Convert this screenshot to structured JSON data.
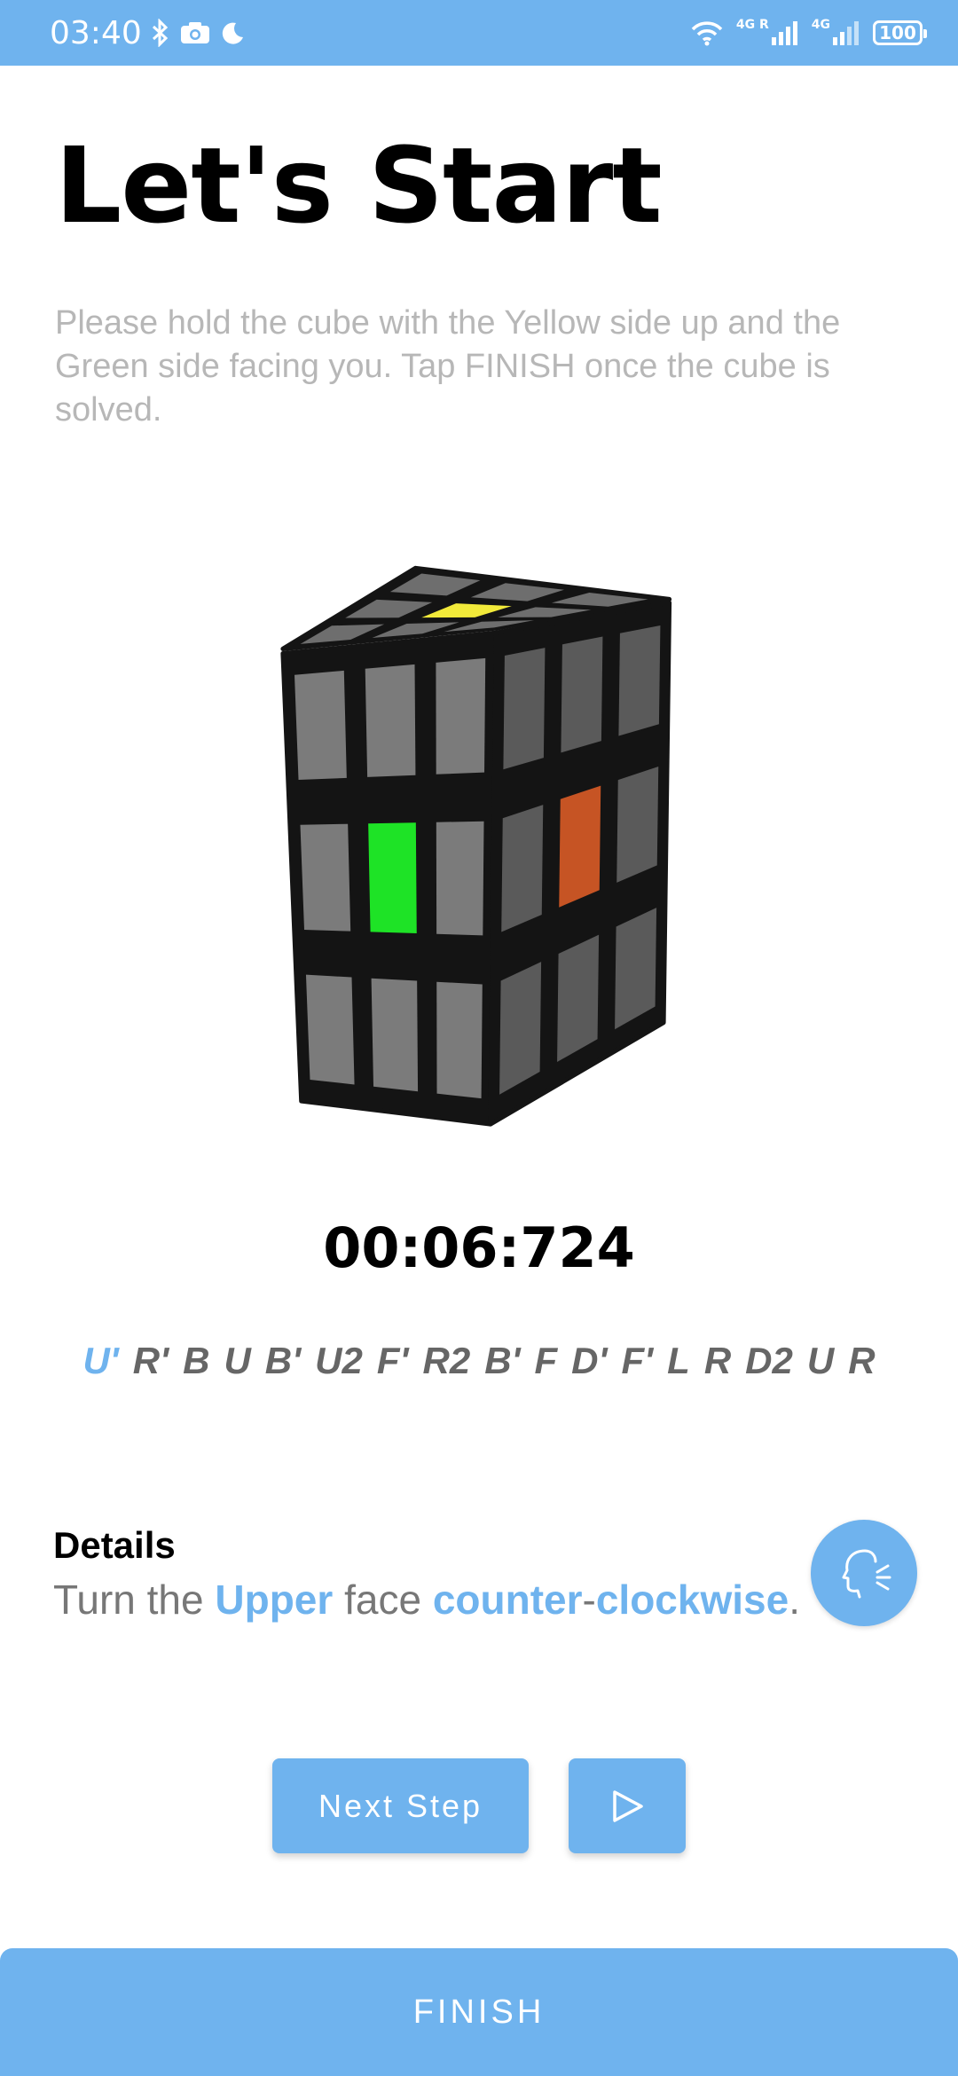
{
  "status_bar": {
    "time": "03:40",
    "network_label_1": "4G R",
    "network_label_2": "4G",
    "battery": "100"
  },
  "header": {
    "title": "Let's Start"
  },
  "instructions": "Please hold the cube with the Yellow side up and the Green side facing you. Tap FINISH once the cube is solved.",
  "cube": {
    "colors": {
      "base": "#727272",
      "yellow": "#f2ea3a",
      "green": "#1ee326",
      "orange": "#c65424"
    }
  },
  "timer": "00:06:724",
  "scramble": {
    "moves": [
      "U'",
      "R'",
      "B",
      "U",
      "B'",
      "U2",
      "F'",
      "R2",
      "B'",
      "F",
      "D'",
      "F'",
      "L",
      "R",
      "D2",
      "U",
      "R"
    ],
    "current_index": 0
  },
  "details": {
    "heading": "Details",
    "text_parts": [
      "Turn the ",
      "Upper",
      " face ",
      "counter",
      "-",
      "clockwise",
      "."
    ]
  },
  "controls": {
    "next_step_label": "Next Step",
    "play_glyph": "▷",
    "finish_label": "FINISH"
  },
  "theme": {
    "accent": "#6fb3ee"
  }
}
